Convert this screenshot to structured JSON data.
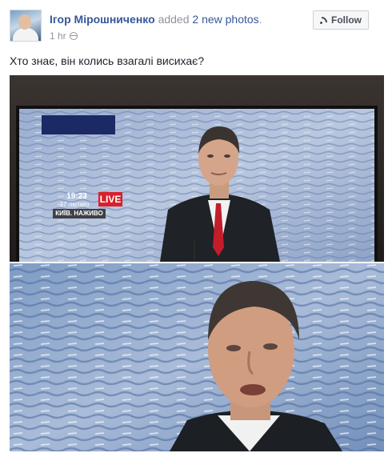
{
  "post": {
    "author": "Ігор Мірошниченко",
    "action_prefix": "added",
    "action_count": "2 new photos",
    "action_suffix": ".",
    "time": "1 hr",
    "privacy_icon": "globe-icon",
    "follow_label": "Follow",
    "follow_icon": "rss-icon",
    "text": "Хто знає, він колись взагалі висихає?"
  },
  "photo1": {
    "ticker_time": "19:23",
    "ticker_date": "17 лютого",
    "live_label": "LIVE",
    "ticker_place": "КИЇВ. НАЖИВО"
  },
  "colors": {
    "link": "#365899",
    "muted": "#90949c",
    "live_red": "#d8202a"
  }
}
